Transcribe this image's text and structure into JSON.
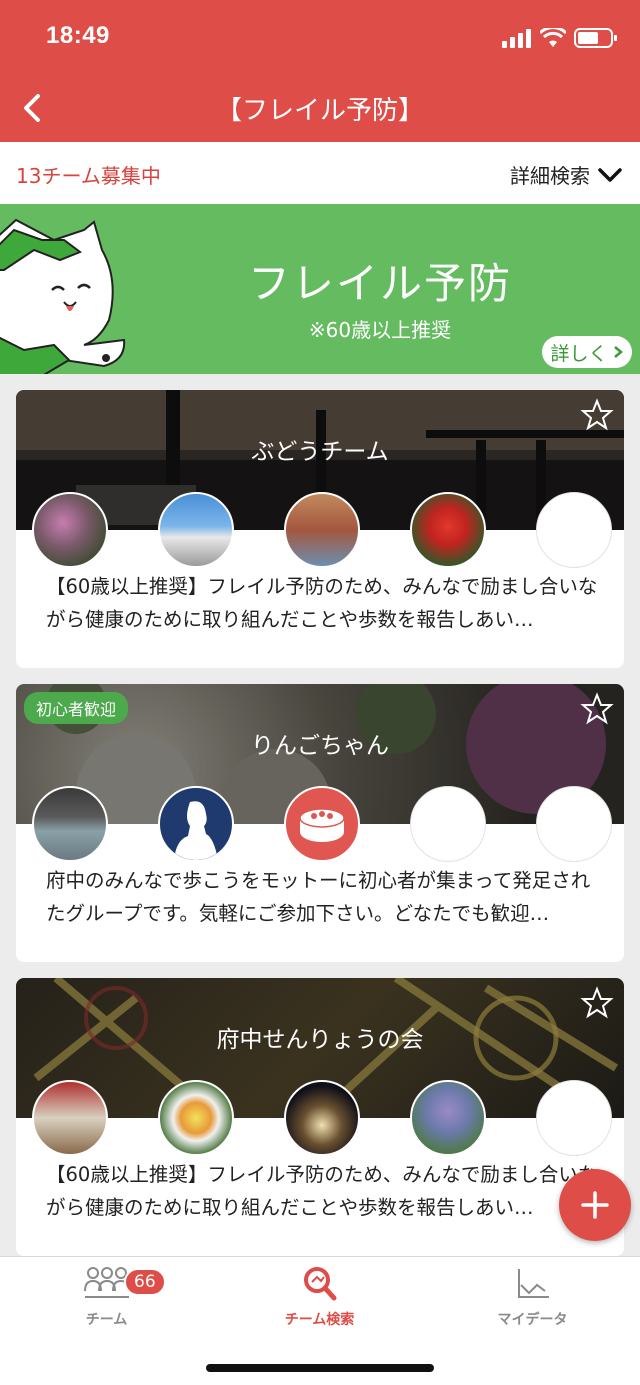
{
  "status": {
    "time": "18:49",
    "battery_icon": "battery-icon",
    "wifi_icon": "wifi-icon",
    "signal_icon": "signal-icon"
  },
  "nav": {
    "title": "【フレイル予防】",
    "back_icon": "chevron-left-icon"
  },
  "subbar": {
    "count": "13チーム募集中",
    "detail_search": "詳細検索"
  },
  "banner": {
    "title": "フレイル予防",
    "subtitle": "※60歳以上推奨",
    "more": "詳しく"
  },
  "cards": [
    {
      "name": "ぶどうチーム",
      "badge": "",
      "desc": "【60歳以上推奨】フレイル予防のため、みんなで励まし合いながら健康のために取り組んだことや歩数を報告しあい…",
      "favorite": false
    },
    {
      "name": "りんごちゃん",
      "badge": "初心者歓迎",
      "desc": "府中のみんなで歩こうをモットーに初心者が集まって発足されたグループです。気軽にご参加下さい。どなたでも歓迎…",
      "favorite": false
    },
    {
      "name": "府中せんりょうの会",
      "badge": "",
      "desc": "【60歳以上推奨】フレイル予防のため、みんなで励まし合いながら健康のために取り組んだことや歩数を報告しあい…",
      "favorite": false
    }
  ],
  "tabs": [
    {
      "label": "チーム",
      "icon": "team-icon",
      "badge": "66",
      "active": false
    },
    {
      "label": "チーム検索",
      "icon": "search-icon",
      "active": true
    },
    {
      "label": "マイデータ",
      "icon": "chart-icon",
      "active": false
    }
  ],
  "colors": {
    "primary": "#de4d47",
    "banner_green": "#65bb60",
    "badge_green": "#4caa4c"
  }
}
